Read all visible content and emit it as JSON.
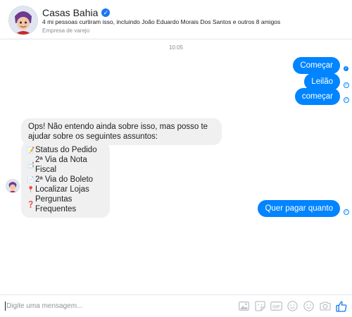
{
  "header": {
    "page_name": "Casas Bahia",
    "likes_text": "4 mi pessoas curtiram isso, incluindo João Eduardo Morais Dos Santos e outros 8 amigos",
    "category": "Empresa de varejo"
  },
  "conversation": {
    "timestamp": "10:05",
    "outgoing_1": "Começar",
    "outgoing_2": "Leilão",
    "outgoing_3": "começar",
    "reply_text": "Ops! Não entendo ainda sobre isso, mas posso te ajudar sobre os seguintes assuntos:",
    "menu": [
      {
        "emoji": "📝",
        "label": "Status do Pedido"
      },
      {
        "emoji": "📑",
        "label": "2ª Via da Nota Fiscal"
      },
      {
        "emoji": "📄",
        "label": "2ª Via do Boleto"
      },
      {
        "emoji": "📍",
        "label": "Localizar Lojas"
      },
      {
        "emoji": "❓",
        "label": "Perguntas Frequentes"
      }
    ],
    "outgoing_4": "Quer pagar quanto"
  },
  "composer": {
    "placeholder": "Digite uma mensagem..."
  },
  "colors": {
    "accent": "#0084ff",
    "incoming_bubble": "#f1f0f0",
    "verified": "#1877f2",
    "like_blue": "#1877f2"
  },
  "icons": [
    "verified-badge-icon",
    "seen-icon",
    "image-icon",
    "sticker-icon",
    "gif-icon",
    "emoji-icon",
    "camera-icon",
    "thumbs-up-icon"
  ]
}
